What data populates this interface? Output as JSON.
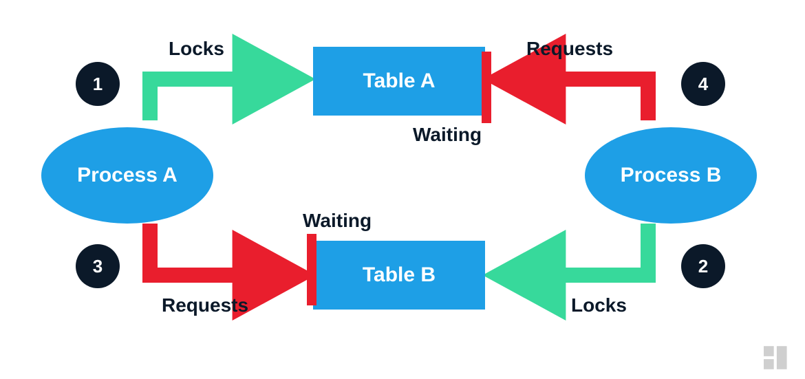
{
  "colors": {
    "blue": "#1e9fe6",
    "green": "#37d99b",
    "red": "#e91e2d",
    "dark": "#0b1929",
    "gray": "#cfcfcf"
  },
  "processA": {
    "label": "Process A"
  },
  "processB": {
    "label": "Process B"
  },
  "tableA": {
    "label": "Table A"
  },
  "tableB": {
    "label": "Table B"
  },
  "badges": {
    "one": "1",
    "two": "2",
    "three": "3",
    "four": "4"
  },
  "labels": {
    "locksLeft": "Locks",
    "locksRight": "Locks",
    "requestsLeft": "Requests",
    "requestsRight": "Requests",
    "waitingTop": "Waiting",
    "waitingBottom": "Waiting"
  }
}
